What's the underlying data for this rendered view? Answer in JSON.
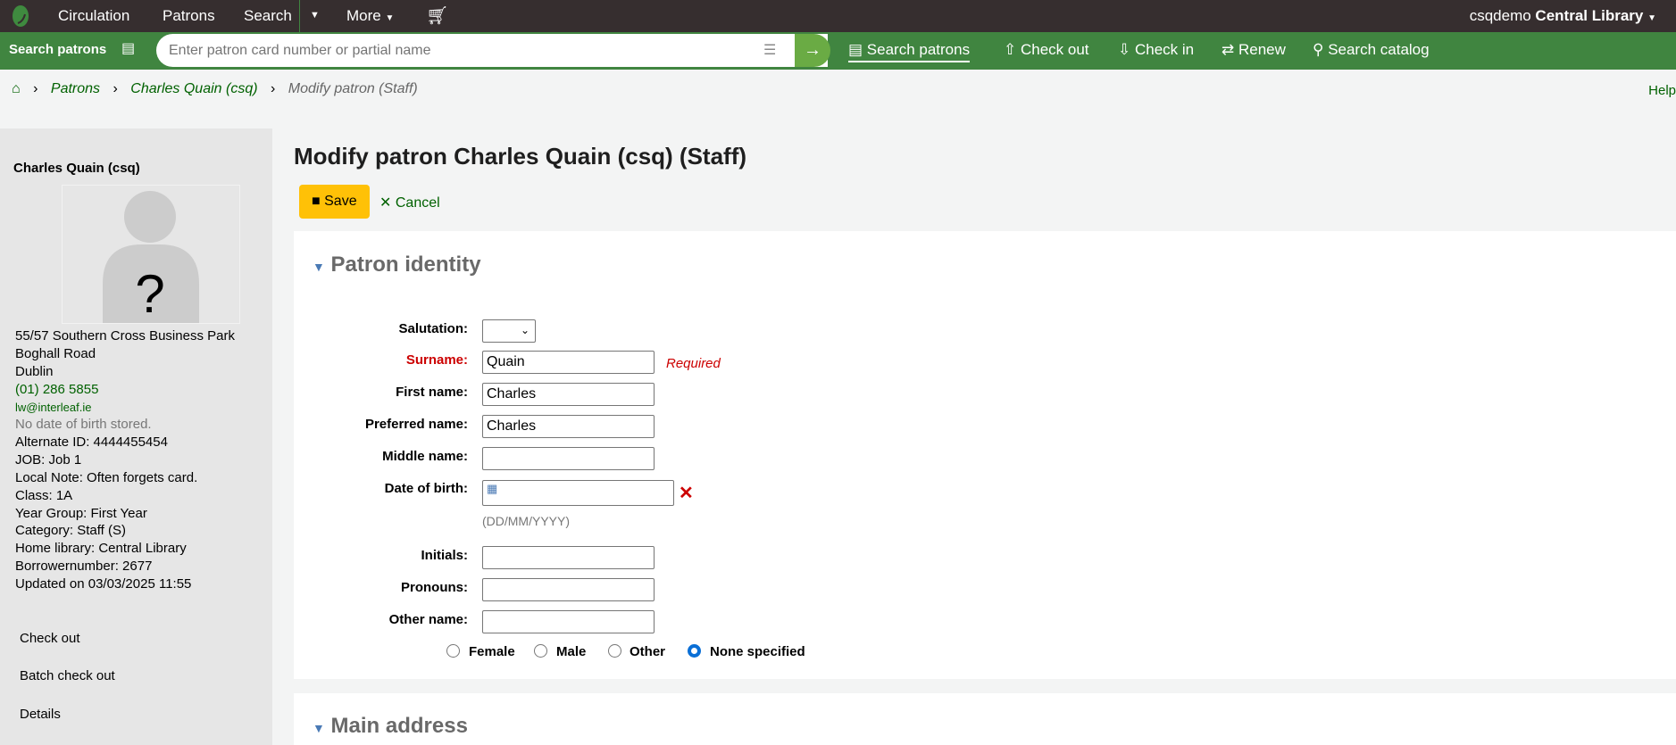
{
  "topnav": {
    "circulation": "Circulation",
    "patrons": "Patrons",
    "search": "Search",
    "more": "More",
    "user": "csqdemo",
    "library": "Central Library"
  },
  "searchbar": {
    "label": "Search patrons",
    "placeholder": "Enter patron card number or partial name",
    "links": [
      "Search patrons",
      "Check out",
      "Check in",
      "Renew",
      "Search catalog"
    ]
  },
  "breadcrumb": {
    "patrons": "Patrons",
    "patron": "Charles Quain (csq)",
    "current": "Modify patron (Staff)",
    "help": "Help"
  },
  "sidebar": {
    "name": "Charles Quain (csq)",
    "address": [
      "55/57 Southern Cross Business Park",
      "Boghall Road",
      "Dublin"
    ],
    "phone": "(01) 286 5855",
    "email": "lw@interleaf.ie",
    "dob": "No date of birth stored.",
    "info": [
      "Alternate ID: 4444455454",
      "JOB: Job 1",
      "Local Note: Often forgets card.",
      "Class: 1A",
      "Year Group: First Year",
      "Category: Staff (S)",
      "Home library: Central Library",
      "Borrowernumber: 2677",
      "Updated on 03/03/2025 11:55"
    ],
    "links": [
      "Check out",
      "Batch check out",
      "Details"
    ]
  },
  "main": {
    "title": "Modify patron Charles Quain (csq) (Staff)",
    "save": "Save",
    "cancel": "Cancel",
    "section1": "Patron identity",
    "section2": "Main address",
    "fields": {
      "salutation": "Salutation:",
      "surname": "Surname:",
      "surname_value": "Quain",
      "required": "Required",
      "firstname": "First name:",
      "firstname_value": "Charles",
      "preferred": "Preferred name:",
      "preferred_value": "Charles",
      "middle": "Middle name:",
      "dob": "Date of birth:",
      "dob_format": "(DD/MM/YYYY)",
      "initials": "Initials:",
      "pronouns": "Pronouns:",
      "othername": "Other name:"
    },
    "gender": {
      "female": "Female",
      "male": "Male",
      "other": "Other",
      "none": "None specified",
      "selected": "None specified"
    }
  },
  "colors": {
    "topnav": "#362e2f",
    "green": "#408540",
    "link": "#006100",
    "save": "#ffc107",
    "required": "#cc0000"
  }
}
